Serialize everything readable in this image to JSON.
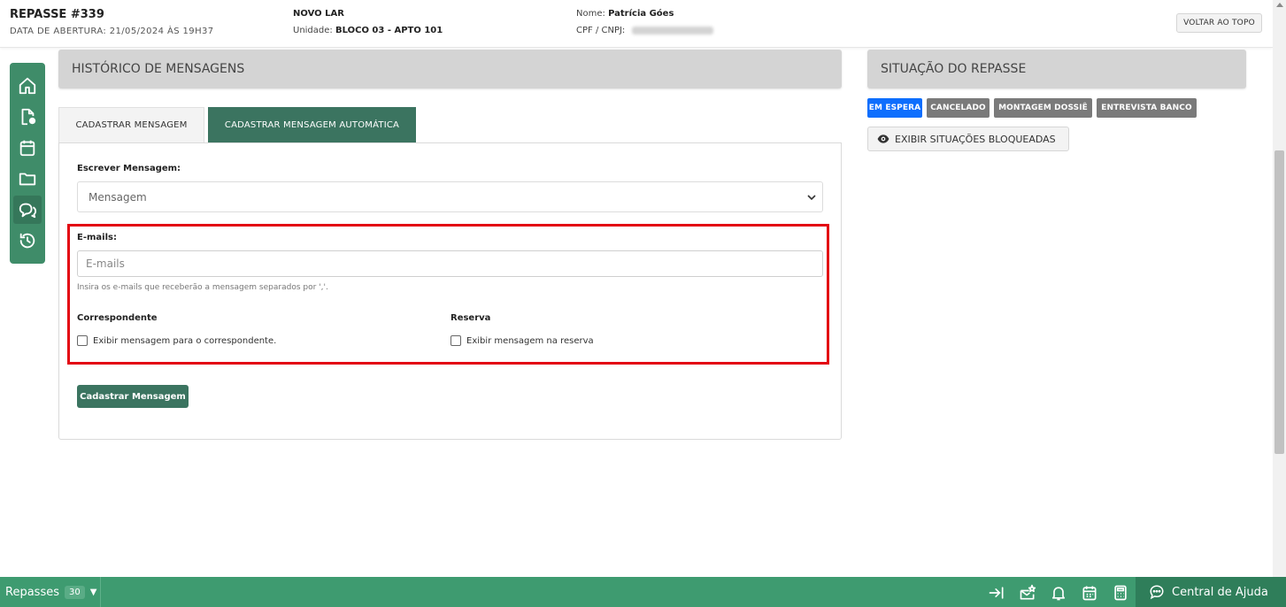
{
  "header": {
    "title": "REPASSE #339",
    "opened": "DATA DE ABERTURA: 21/05/2024 ÀS 19H37",
    "project": "NOVO LAR",
    "unit_label": "Unidade:",
    "unit_value": "BLOCO 03 - APTO 101",
    "name_label": "Nome:",
    "name_value": "Patrícia Góes",
    "cpf_label": "CPF / CNPJ:",
    "back_to_top": "VOLTAR AO TOPO"
  },
  "sidenav": {
    "items": [
      {
        "icon": "home-icon"
      },
      {
        "icon": "document-icon"
      },
      {
        "icon": "calendar-icon"
      },
      {
        "icon": "folder-icon"
      },
      {
        "icon": "chat-icon"
      },
      {
        "icon": "history-icon"
      }
    ]
  },
  "messages": {
    "panel_title": "HISTÓRICO DE MENSAGENS",
    "tabs": [
      {
        "label": "CADASTRAR MENSAGEM"
      },
      {
        "label": "CADASTRAR MENSAGEM AUTOMÁTICA"
      }
    ],
    "write_label": "Escrever Mensagem:",
    "select_value": "Mensagem",
    "emails_label": "E-mails:",
    "emails_placeholder": "E-mails",
    "emails_help": "Insira os e-mails que receberão a mensagem separados por ','.",
    "correspondent_label": "Correspondente",
    "correspondent_check": "Exibir mensagem para o correspondente.",
    "reserve_label": "Reserva",
    "reserve_check": "Exibir mensagem na reserva",
    "submit_label": "Cadastrar Mensagem"
  },
  "status": {
    "panel_title": "SITUAÇÃO DO REPASSE",
    "badges": [
      {
        "label": "EM ESPERA",
        "color": "#0d6efd"
      },
      {
        "label": "CANCELADO",
        "color": "#7a7a7a"
      },
      {
        "label": "MONTAGEM DOSSIÊ",
        "color": "#7a7a7a"
      },
      {
        "label": "ENTREVISTA BANCO",
        "color": "#7a7a7a"
      }
    ],
    "show_blocked": "EXIBIR SITUAÇÕES BLOQUEADAS"
  },
  "footer": {
    "repasses_label": "Repasses",
    "repasses_count": "30",
    "help_label": "Central de Ajuda"
  },
  "colors": {
    "primary_green": "#3b7460",
    "footer_green": "#3e9b70",
    "highlight_red": "#e30613"
  }
}
